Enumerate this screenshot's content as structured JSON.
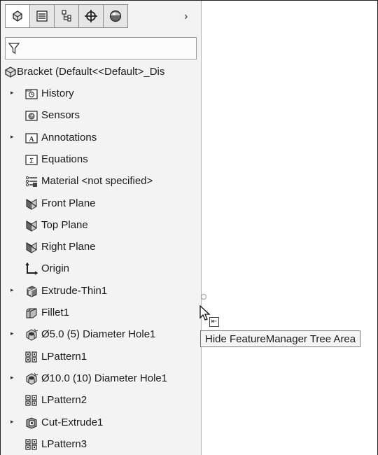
{
  "panel": {
    "tabs": [
      {
        "icon": "part-icon"
      },
      {
        "icon": "property-manager-icon"
      },
      {
        "icon": "configuration-manager-icon"
      },
      {
        "icon": "dimxpert-manager-icon"
      },
      {
        "icon": "display-manager-icon"
      }
    ],
    "chevron": "›",
    "filter_icon": "filter-icon"
  },
  "tree": {
    "root": {
      "label": "Bracket  (Default<<Default>_Dis",
      "icon": "part-icon"
    },
    "items": [
      {
        "label": "History",
        "icon": "history-folder-icon",
        "expandable": true
      },
      {
        "label": "Sensors",
        "icon": "sensors-folder-icon",
        "expandable": false
      },
      {
        "label": "Annotations",
        "icon": "annotations-folder-icon",
        "expandable": true
      },
      {
        "label": "Equations",
        "icon": "equations-folder-icon",
        "expandable": false
      },
      {
        "label": "Material <not specified>",
        "icon": "material-icon",
        "expandable": false
      },
      {
        "label": "Front Plane",
        "icon": "plane-icon",
        "expandable": false
      },
      {
        "label": "Top Plane",
        "icon": "plane-icon",
        "expandable": false
      },
      {
        "label": "Right Plane",
        "icon": "plane-icon",
        "expandable": false
      },
      {
        "label": "Origin",
        "icon": "origin-icon",
        "expandable": false
      },
      {
        "label": "Extrude-Thin1",
        "icon": "extrude-icon",
        "expandable": true
      },
      {
        "label": "Fillet1",
        "icon": "fillet-icon",
        "expandable": false
      },
      {
        "label": "Ø5.0 (5) Diameter Hole1",
        "icon": "hole-wizard-icon",
        "expandable": true
      },
      {
        "label": "LPattern1",
        "icon": "linear-pattern-icon",
        "expandable": false
      },
      {
        "label": "Ø10.0 (10) Diameter Hole1",
        "icon": "hole-wizard-icon",
        "expandable": true
      },
      {
        "label": "LPattern2",
        "icon": "linear-pattern-icon",
        "expandable": false
      },
      {
        "label": "Cut-Extrude1",
        "icon": "cut-extrude-icon",
        "expandable": true
      },
      {
        "label": "LPattern3",
        "icon": "linear-pattern-icon",
        "expandable": false
      }
    ]
  },
  "tooltip": {
    "text": "Hide FeatureManager Tree Area"
  },
  "expand_glyph": "▸"
}
